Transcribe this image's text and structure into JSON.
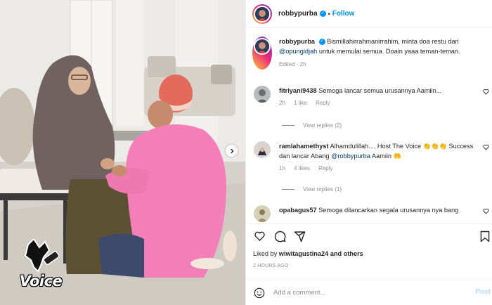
{
  "post": {
    "username": "robbypurba",
    "follow_label": "Follow",
    "caption": {
      "username": "robbypurba",
      "text_before": "Bismillahirrahmanirrahim, minta doa restu dari",
      "mention": "@opungidjah",
      "text_after": "untuk memulai semua. Doain yaaa teman-teman.",
      "meta": "Edited · 2h"
    },
    "comments": [
      {
        "username": "fitriyani9438",
        "text": "Semoga lancar semua urusannya Aamiin...",
        "time": "2h",
        "likes": "1 like",
        "reply_label": "Reply",
        "view_replies": "View replies (2)"
      },
      {
        "username": "ramlahamethyst",
        "text_before": "Alhamdulillah.... Host The Voice 👏👏👏 Success dan lancar Abang",
        "mention": "@robbypurba",
        "text_after": "Aamiin 🤲",
        "time": "1h",
        "likes": "4 likes",
        "reply_label": "Reply",
        "view_replies": "View replies (1)"
      },
      {
        "username": "opabagus57",
        "text": "Semoga dilancarkan segala urusannya nya bang"
      }
    ],
    "liked_by_prefix": "Liked by",
    "liked_by_user": "wiwitagustina24",
    "liked_by_suffix": "and others",
    "timestamp": "2 HOURS AGO",
    "add_comment_placeholder": "Add a comment...",
    "post_label": "Post",
    "watermark": "Voice"
  },
  "icons": [
    "heart-icon",
    "comment-icon",
    "share-icon",
    "bookmark-icon",
    "emoji-icon",
    "verified-icon",
    "next-arrow-icon"
  ],
  "colors": {
    "link": "#0095f6",
    "mention": "#00376b",
    "muted": "#8e8e8e",
    "sweater": "#f47fb8",
    "hijab": "#6f6261"
  }
}
